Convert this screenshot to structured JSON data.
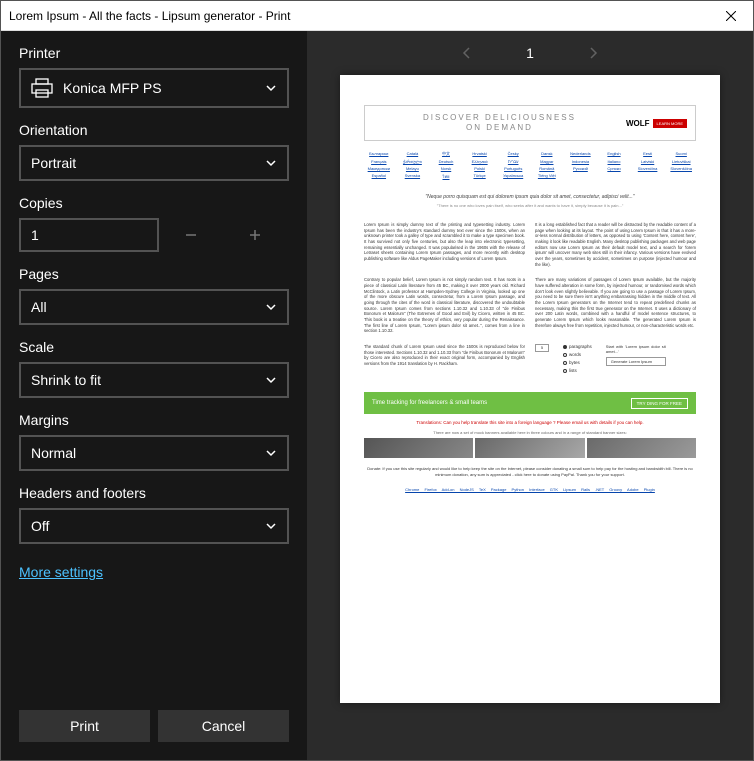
{
  "window": {
    "title": "Lorem Ipsum - All the facts - Lipsum generator - Print"
  },
  "sidebar": {
    "printer": {
      "label": "Printer",
      "value": "Konica MFP PS"
    },
    "orientation": {
      "label": "Orientation",
      "value": "Portrait"
    },
    "copies": {
      "label": "Copies",
      "value": "1"
    },
    "pages": {
      "label": "Pages",
      "value": "All"
    },
    "scale": {
      "label": "Scale",
      "value": "Shrink to fit"
    },
    "margins": {
      "label": "Margins",
      "value": "Normal"
    },
    "headers": {
      "label": "Headers and footers",
      "value": "Off"
    },
    "more": "More settings",
    "print_btn": "Print",
    "cancel_btn": "Cancel"
  },
  "preview": {
    "page_number": "1",
    "ad": {
      "text_line1": "DISCOVER DELICIOUSNESS",
      "text_line2": "ON DEMAND",
      "brand": "WOLF",
      "cta": "LEARN MORE"
    },
    "languages": [
      "Български",
      "Català",
      "中文",
      "Hrvatski",
      "Česky",
      "Dansk",
      "Nederlands",
      "English",
      "Eesti",
      "Suomi",
      "Français",
      "ქართული",
      "Deutsch",
      "Ελληνικά",
      "עברית",
      "Magyar",
      "Indonesia",
      "Italiano",
      "Latviski",
      "Lietuviškai",
      "Македонски",
      "Melayu",
      "Norsk",
      "Polski",
      "Português",
      "Română",
      "Русский",
      "Српски",
      "Slovenčina",
      "Slovenščina",
      "Español",
      "Svenska",
      "ไทย",
      "Türkçe",
      "Українська",
      "Tiếng Việt"
    ],
    "quote": "\"Neque porro quisquam est qui dolorem ipsum quia dolor sit amet, consectetur, adipisci velit...\"",
    "quote_sub": "\"There is no one who loves pain itself, who seeks after it and wants to have it, simply because it is pain...\"",
    "para1_left": "Lorem Ipsum is simply dummy text of the printing and typesetting industry. Lorem Ipsum has been the industry's standard dummy text ever since the 1500s, when an unknown printer took a galley of type and scrambled it to make a type specimen book. It has survived not only five centuries, but also the leap into electronic typesetting, remaining essentially unchanged. It was popularised in the 1960s with the release of Letraset sheets containing Lorem Ipsum passages, and more recently with desktop publishing software like Aldus PageMaker including versions of Lorem Ipsum.",
    "para1_right": "It is a long established fact that a reader will be distracted by the readable content of a page when looking at its layout. The point of using Lorem Ipsum is that it has a more-or-less normal distribution of letters, as opposed to using 'Content here, content here', making it look like readable English. Many desktop publishing packages and web page editors now use Lorem Ipsum as their default model text, and a search for 'lorem ipsum' will uncover many web sites still in their infancy. Various versions have evolved over the years, sometimes by accident, sometimes on purpose (injected humour and the like).",
    "para2_left": "Contrary to popular belief, Lorem Ipsum is not simply random text. It has roots in a piece of classical Latin literature from 45 BC, making it over 2000 years old. Richard McClintock, a Latin professor at Hampden-Sydney College in Virginia, looked up one of the more obscure Latin words, consectetur, from a Lorem Ipsum passage, and going through the cites of the word in classical literature, discovered the undoubtable source. Lorem Ipsum comes from sections 1.10.32 and 1.10.33 of \"de Finibus Bonorum et Malorum\" (The Extremes of Good and Evil) by Cicero, written in 45 BC. This book is a treatise on the theory of ethics, very popular during the Renaissance. The first line of Lorem Ipsum, \"Lorem ipsum dolor sit amet..\", comes from a line in section 1.10.32.",
    "para2_right": "There are many variations of passages of Lorem Ipsum available, but the majority have suffered alteration in some form, by injected humour, or randomised words which don't look even slightly believable. If you are going to use a passage of Lorem Ipsum, you need to be sure there isn't anything embarrassing hidden in the middle of text. All the Lorem Ipsum generators on the Internet tend to repeat predefined chunks as necessary, making this the first true generator on the Internet. It uses a dictionary of over 200 Latin words, combined with a handful of model sentence structures, to generate Lorem Ipsum which looks reasonable. The generated Lorem Ipsum is therefore always free from repetition, injected humour, or non-characteristic words etc.",
    "para3_left": "The standard chunk of Lorem Ipsum used since the 1500s is reproduced below for those interested. Sections 1.10.32 and 1.10.33 from \"de Finibus Bonorum et Malorum\" by Cicero are also reproduced in their exact original form, accompanied by English versions from the 1914 translation by H. Rackham.",
    "form": {
      "count": "5",
      "opt_paragraphs": "paragraphs",
      "opt_words": "words",
      "opt_bytes": "bytes",
      "opt_lists": "lists",
      "start_with": "Start with 'Lorem ipsum dolor sit amet...'",
      "generate": "Generate Lorem Ipsum"
    },
    "green_banner": {
      "text": "Time tracking for freelancers & small teams",
      "cta": "TRY DING FOR FREE"
    },
    "translations": "Translations: Can you help translate this site into a foreign language ? Please email us with details if you can help.",
    "banners_note": "There are now a set of mock banners available here in three colours and in a range of standard banner sizes:",
    "donate": "Donate: If you use this site regularly and would like to help keep the site on the Internet, please consider donating a small sum to help pay for the hosting and bandwidth bill. There is no minimum donation, any sum is appreciated - click here to donate using PayPal. Thank you for your support.",
    "footer": "Chrome  Firefox Add-on  NodeJS  TeX Package  Python Interface  GTK Lipsum  Rails  .NET  Groovy  Adobe Plugin"
  }
}
